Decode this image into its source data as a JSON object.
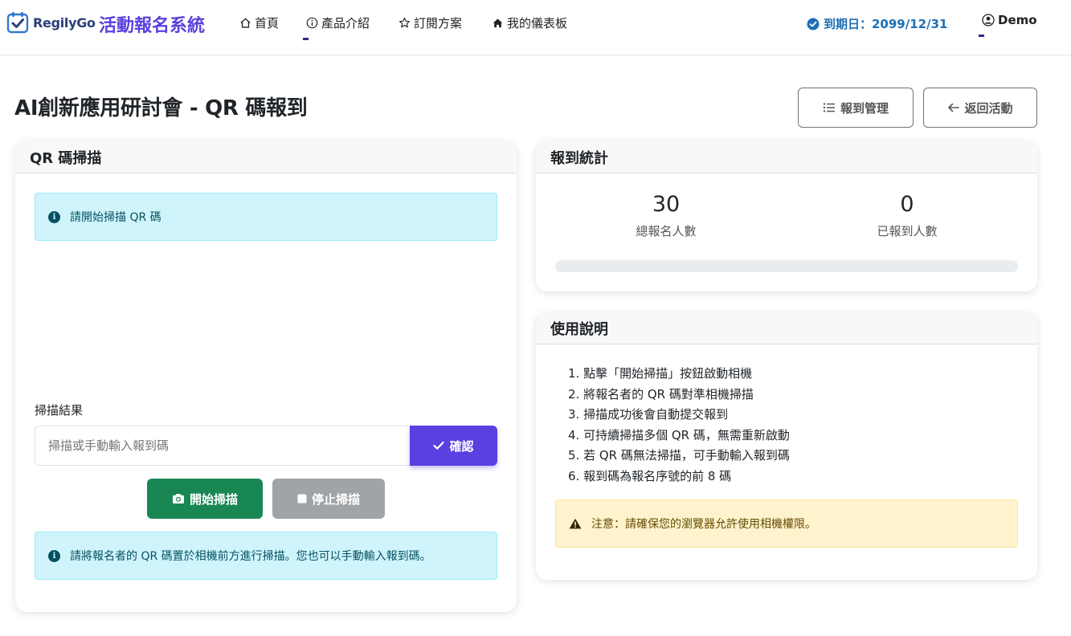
{
  "nav": {
    "brand": "RegilyGo",
    "system_name": "活動報名系統",
    "items": [
      {
        "label": "首頁",
        "icon": "home-icon"
      },
      {
        "label": "產品介紹",
        "icon": "info-circle-icon"
      },
      {
        "label": "訂閱方案",
        "icon": "star-icon"
      },
      {
        "label": "我的儀表板",
        "icon": "home-filled-icon"
      }
    ],
    "expiry": "到期日：2099/12/31",
    "user": "Demo"
  },
  "page": {
    "title": "AI創新應用研討會 - QR 碼報到",
    "manage_button": "報到管理",
    "back_button": "返回活動"
  },
  "scanner": {
    "header": "QR 碼掃描",
    "info": "請開始掃描 QR 碼",
    "result_label": "掃描結果",
    "input_placeholder": "掃描或手動輸入報到碼",
    "input_value": "",
    "confirm_button": "確認",
    "start_button": "開始掃描",
    "stop_button": "停止掃描",
    "hint": "請將報名者的 QR 碼置於相機前方進行掃描。您也可以手動輸入報到碼。"
  },
  "stats": {
    "header": "報到統計",
    "total_value": "30",
    "total_label": "總報名人數",
    "checked_value": "0",
    "checked_label": "已報到人數",
    "progress_percent": 0
  },
  "instructions": {
    "header": "使用說明",
    "items": [
      "1. 點擊「開始掃描」按鈕啟動相機",
      "2. 將報名者的 QR 碼對準相機掃描",
      "3. 掃描成功後會自動提交報到",
      "4. 可持續掃描多個 QR 碼，無需重新啟動",
      "5. 若 QR 碼無法掃描，可手動輸入報到碼",
      "6. 報到碼為報名序號的前 8 碼"
    ],
    "warning": "注意：請確保您的瀏覽器允許使用相機權限。"
  },
  "colors": {
    "primary": "#5b3fe0",
    "success": "#198754",
    "secondary": "#a0a4a8",
    "info_bg": "#cff4fc",
    "warning_bg": "#fff3cd",
    "expiry_blue": "#1e6fb5"
  }
}
